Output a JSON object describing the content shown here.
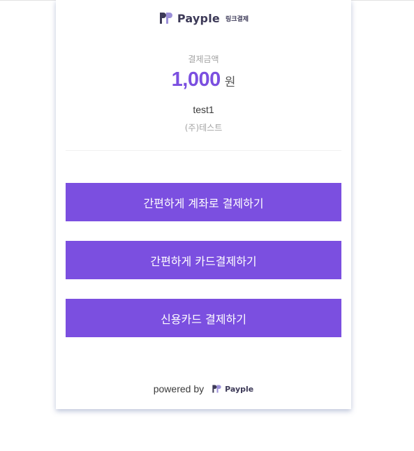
{
  "header": {
    "brand": "Payple",
    "subtitle": "링크결제",
    "logo_icon": "payple-pp-logo-icon"
  },
  "payment": {
    "amount_label": "결제금액",
    "amount": "1,000",
    "currency_unit": "원",
    "product": "test1",
    "merchant": "(주)테스트"
  },
  "buttons": {
    "easy_account": "간편하게 계좌로 결제하기",
    "easy_card": "간편하게 카드결제하기",
    "credit_card": "신용카드 결제하기"
  },
  "footer": {
    "powered_by": "powered by",
    "brand": "Payple"
  },
  "colors": {
    "accent": "#7b4fe0",
    "brand_dark": "#3d3a58",
    "logo_light": "#9b8fd8"
  }
}
